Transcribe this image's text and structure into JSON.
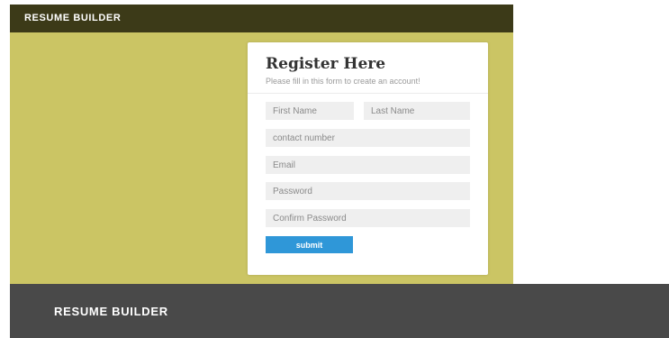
{
  "header": {
    "brand": "RESUME BUILDER"
  },
  "form": {
    "title": "Register Here",
    "subtitle": "Please fill in this form to create an account!",
    "first_name_placeholder": "First Name",
    "last_name_placeholder": "Last Name",
    "contact_placeholder": "contact number",
    "email_placeholder": "Email",
    "password_placeholder": "Password",
    "confirm_password_placeholder": "Confirm Password",
    "submit_label": "submit"
  },
  "footer": {
    "brand": "RESUME BUILDER"
  },
  "colors": {
    "header_bg": "#3c3a18",
    "hero_bg": "#cbc564",
    "submit_bg": "#2f97d8",
    "footer_bg": "#494949"
  }
}
